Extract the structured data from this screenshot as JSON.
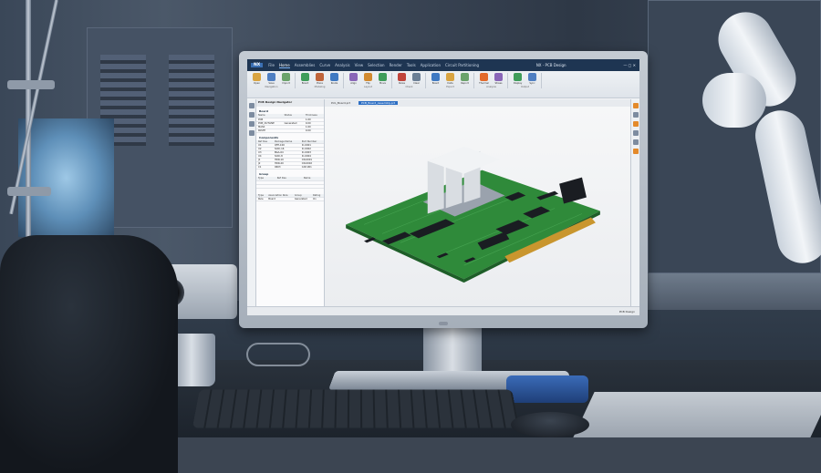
{
  "window": {
    "brand": "NX",
    "title": "NX - PCB Design",
    "controls": "— ▢ ✕"
  },
  "menu_tabs": [
    {
      "label": "File"
    },
    {
      "label": "Home",
      "active": true
    },
    {
      "label": "Assemblies"
    },
    {
      "label": "Curve"
    },
    {
      "label": "Analysis"
    },
    {
      "label": "View"
    },
    {
      "label": "Selection"
    },
    {
      "label": "Render"
    },
    {
      "label": "Tools"
    },
    {
      "label": "Application"
    },
    {
      "label": "Circuit Partitioning"
    }
  ],
  "ribbon": {
    "groups": [
      {
        "label": "Navigation",
        "buttons": [
          {
            "label": "Open",
            "color": "#d9a441"
          },
          {
            "label": "Save",
            "color": "#4f7fc2"
          },
          {
            "label": "Import",
            "color": "#6aa36b"
          }
        ]
      },
      {
        "label": "Modeling",
        "buttons": [
          {
            "label": "Board",
            "color": "#3f9d5a"
          },
          {
            "label": "Place",
            "color": "#c0643a"
          },
          {
            "label": "Route",
            "color": "#3f79c2"
          }
        ]
      },
      {
        "label": "Layout",
        "buttons": [
          {
            "label": "Align",
            "color": "#8a66b8"
          },
          {
            "label": "Flip",
            "color": "#d28a2f"
          },
          {
            "label": "Move",
            "color": "#3f9d5a"
          }
        ]
      },
      {
        "label": "Check",
        "buttons": [
          {
            "label": "Rules",
            "color": "#c0443a"
          },
          {
            "label": "Clear",
            "color": "#6b7f95"
          }
        ]
      },
      {
        "label": "Export",
        "buttons": [
          {
            "label": "Board",
            "color": "#3f79c2"
          },
          {
            "label": "Data",
            "color": "#d9a441"
          },
          {
            "label": "Report",
            "color": "#6aa36b"
          }
        ]
      },
      {
        "label": "Analysis",
        "buttons": [
          {
            "label": "Thermal",
            "color": "#e36a2b"
          },
          {
            "label": "Stress",
            "color": "#8a66b8"
          }
        ]
      },
      {
        "label": "Output",
        "buttons": [
          {
            "label": "Display",
            "color": "#3f9d5a"
          },
          {
            "label": "Sync",
            "color": "#4f7fc2"
          }
        ]
      }
    ]
  },
  "doc_tabs": [
    {
      "label": "Pcb_Board.prt",
      "active": false
    },
    {
      "label": "PCB_Board_Assembly.prt",
      "active": true
    }
  ],
  "navigator": {
    "title": "PCB Design Navigator",
    "board_section": "Board",
    "board_headers": [
      "Name",
      "Status",
      "Thickness"
    ],
    "board_rows": [
      [
        "PCB",
        "",
        "1.60"
      ],
      [
        "PCB_OUTLINE",
        "Generated",
        "0.00"
      ],
      [
        "MASK",
        "",
        "1.60"
      ],
      [
        "PASTE",
        "",
        "0.00"
      ]
    ],
    "components_section": "Components",
    "component_headers": [
      "Ref Des",
      "Package Name",
      "Part Number"
    ],
    "component_rows": [
      [
        "U1",
        "QFP-100",
        "IC-0001"
      ],
      [
        "U2",
        "SOIC-16",
        "IC-0002"
      ],
      [
        "U3",
        "BGA-64",
        "IC-0003"
      ],
      [
        "U4",
        "SOIC-8",
        "IC-0004"
      ],
      [
        "J1",
        "HDR-10",
        "CN-0001"
      ],
      [
        "J2",
        "HDR-20",
        "CN-0002"
      ],
      [
        "C1",
        "0603",
        "CAP-001"
      ]
    ],
    "group_section": "Group",
    "group_headers": [
      "Type",
      "Ref Des",
      "Name"
    ],
    "group_rows": [
      [
        "",
        "",
        ""
      ],
      [
        "",
        "",
        ""
      ]
    ],
    "bottom_headers": [
      "Type",
      "Association Rule",
      "Group",
      "Rating"
    ],
    "bottom_rows": [
      [
        "Rule",
        "Board",
        "Generated",
        "On"
      ]
    ]
  },
  "status": {
    "text": "PCB Design"
  },
  "pcb": {
    "board_color": "#2f8a3a",
    "board_edge": "#1e5e28",
    "heatsink_color": "#d9dde2",
    "ribbon_cable": "#c9962e"
  }
}
